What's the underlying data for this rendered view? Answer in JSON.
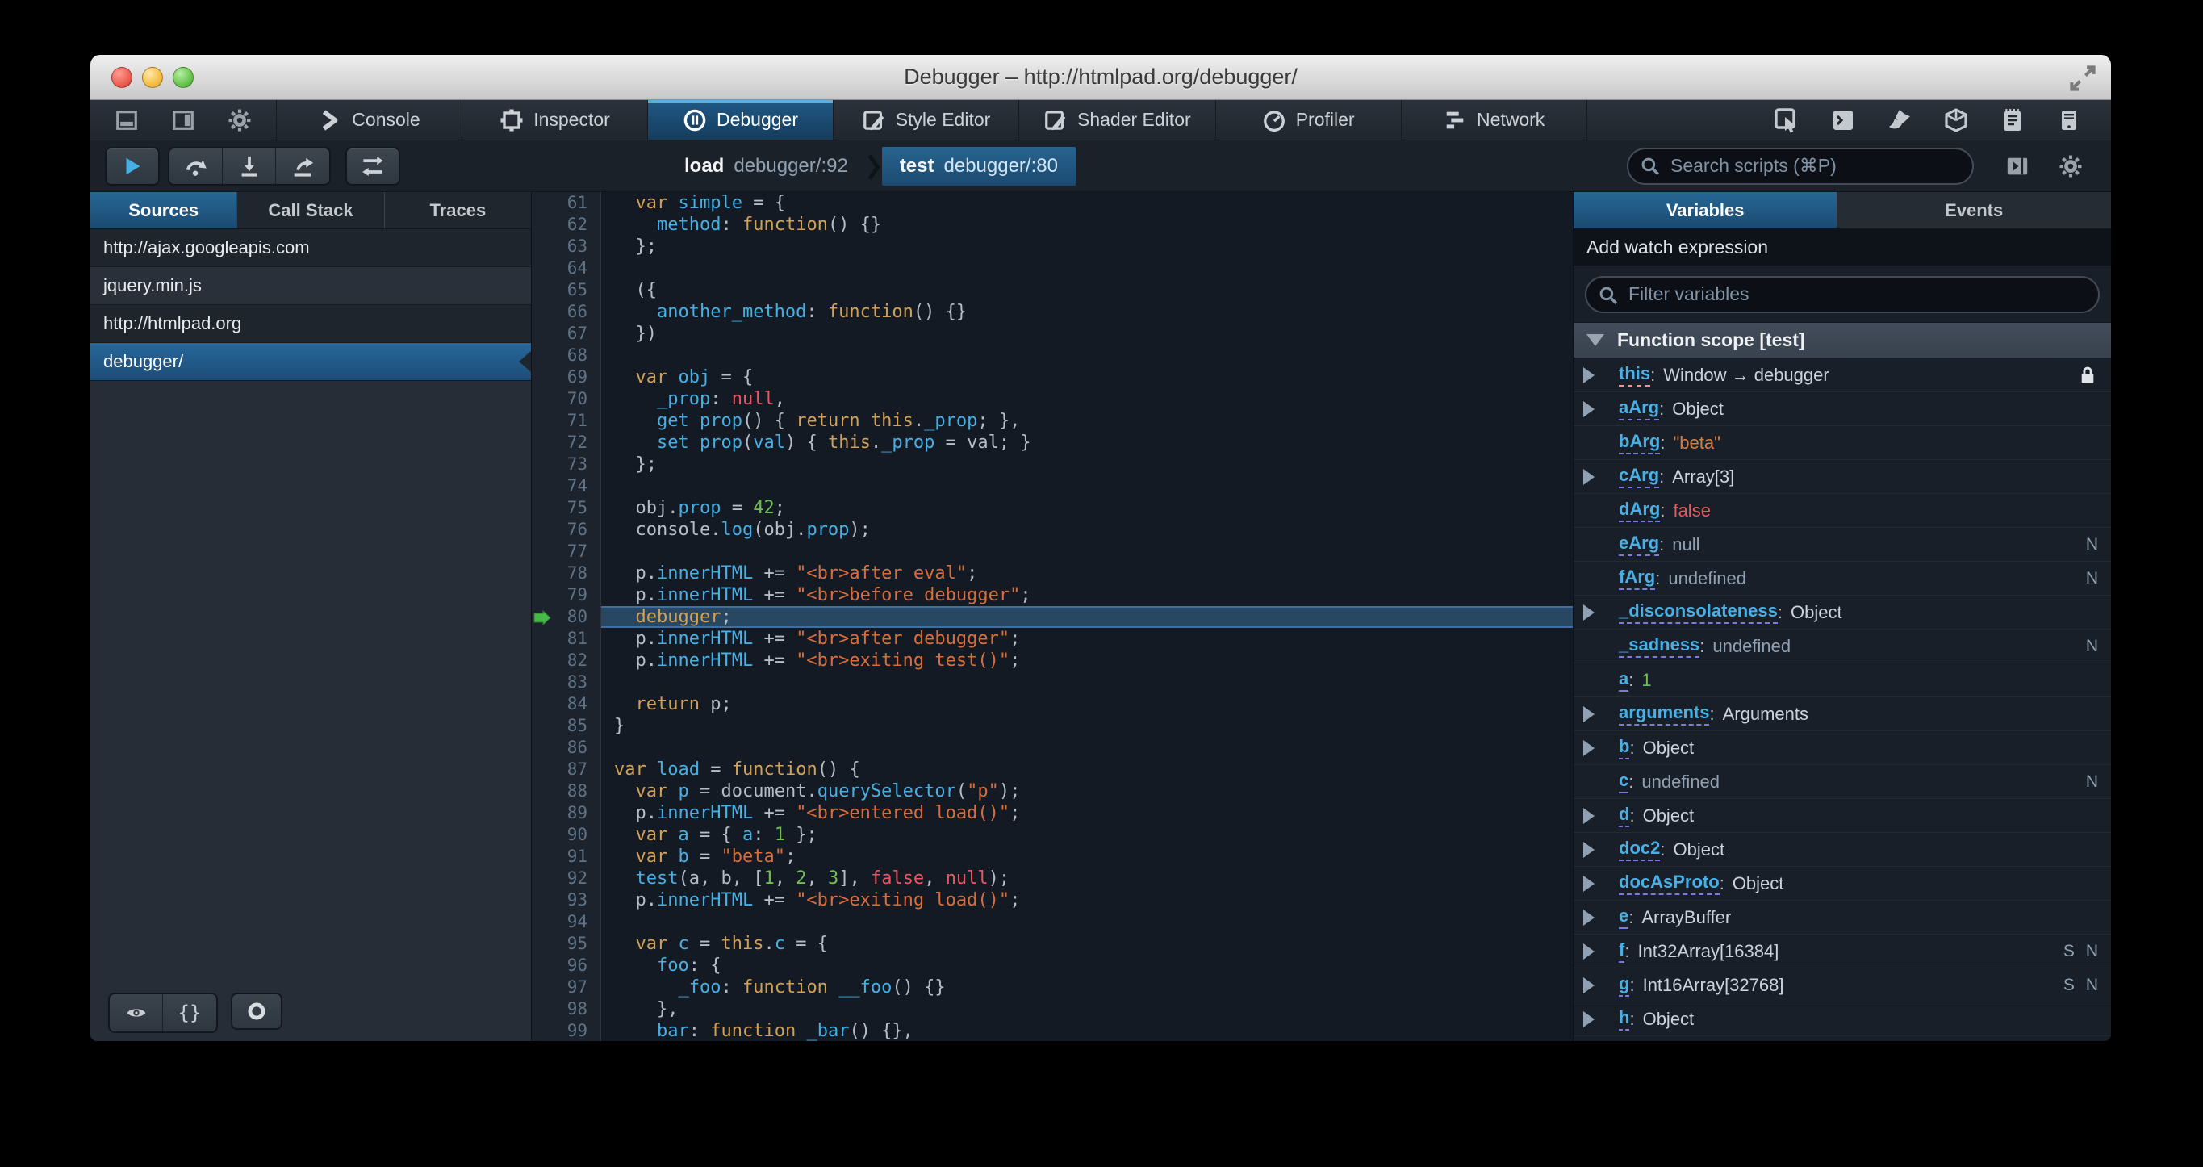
{
  "window": {
    "title": "Debugger – http://htmlpad.org/debugger/"
  },
  "titlebar": {
    "buttons": [
      "close-button",
      "minimize-button",
      "zoom-button"
    ],
    "fullscreen_icon": "fullscreen-arrows-icon"
  },
  "tabbar": {
    "controls": [
      "dock-bottom-icon",
      "dock-side-icon",
      "gear-icon"
    ],
    "tabs": [
      {
        "label": "Console",
        "icon": "console-icon",
        "selected": false
      },
      {
        "label": "Inspector",
        "icon": "inspector-icon",
        "selected": false
      },
      {
        "label": "Debugger",
        "icon": "debugger-icon",
        "selected": true
      },
      {
        "label": "Style Editor",
        "icon": "style-editor-icon",
        "selected": false
      },
      {
        "label": "Shader Editor",
        "icon": "shader-editor-icon",
        "selected": false
      },
      {
        "label": "Profiler",
        "icon": "profiler-icon",
        "selected": false
      },
      {
        "label": "Network",
        "icon": "network-icon",
        "selected": false
      }
    ],
    "toolbox_buttons": [
      "pick-element-icon",
      "split-console-icon",
      "paintbrush-icon",
      "tilt-3d-icon",
      "scratchpad-icon",
      "responsive-mode-icon"
    ]
  },
  "toolbar": {
    "debug_buttons": [
      "resume-icon",
      "step-over-icon",
      "step-in-icon",
      "step-out-icon"
    ],
    "toggle_button": "toggle-arrows-icon",
    "breadcrumb": [
      {
        "fn": "load",
        "loc": "debugger/:92",
        "active": false
      },
      {
        "fn": "test",
        "loc": "debugger/:80",
        "active": true
      }
    ],
    "search_placeholder": "Search scripts (⌘P)",
    "right_icons": [
      "panel-toggle-icon",
      "gear-icon"
    ]
  },
  "sources": {
    "tabs": [
      {
        "label": "Sources",
        "selected": true
      },
      {
        "label": "Call Stack",
        "selected": false
      },
      {
        "label": "Traces",
        "selected": false
      }
    ],
    "items": [
      {
        "label": "http://ajax.googleapis.com",
        "type": "group",
        "selected": false
      },
      {
        "label": "jquery.min.js",
        "type": "file",
        "selected": false
      },
      {
        "label": "http://htmlpad.org",
        "type": "group",
        "selected": false
      },
      {
        "label": "debugger/",
        "type": "file",
        "selected": true
      }
    ],
    "bottom_buttons": [
      "blackbox-eye-icon",
      "prettyprint-braces-icon",
      "trace-circle-icon"
    ]
  },
  "editor": {
    "current_line": 80,
    "lines": [
      {
        "n": 61,
        "t": [
          [
            "d",
            "  "
          ],
          [
            "k",
            "var"
          ],
          [
            "d",
            " "
          ],
          [
            "v",
            "simple"
          ],
          [
            "d",
            " = {"
          ]
        ]
      },
      {
        "n": 62,
        "t": [
          [
            "d",
            "    "
          ],
          [
            "v",
            "method"
          ],
          [
            "d",
            ": "
          ],
          [
            "k",
            "function"
          ],
          [
            "d",
            "() {}"
          ]
        ]
      },
      {
        "n": 63,
        "t": [
          [
            "d",
            "  };"
          ]
        ]
      },
      {
        "n": 64,
        "t": []
      },
      {
        "n": 65,
        "t": [
          [
            "d",
            "  ({"
          ]
        ]
      },
      {
        "n": 66,
        "t": [
          [
            "d",
            "    "
          ],
          [
            "v",
            "another_method"
          ],
          [
            "d",
            ": "
          ],
          [
            "k",
            "function"
          ],
          [
            "d",
            "() {}"
          ]
        ]
      },
      {
        "n": 67,
        "t": [
          [
            "d",
            "  })"
          ]
        ]
      },
      {
        "n": 68,
        "t": []
      },
      {
        "n": 69,
        "t": [
          [
            "d",
            "  "
          ],
          [
            "k",
            "var"
          ],
          [
            "d",
            " "
          ],
          [
            "v",
            "obj"
          ],
          [
            "d",
            " = {"
          ]
        ]
      },
      {
        "n": 70,
        "t": [
          [
            "d",
            "    "
          ],
          [
            "v",
            "_prop"
          ],
          [
            "d",
            ": "
          ],
          [
            "a",
            "null"
          ],
          [
            "d",
            ","
          ]
        ]
      },
      {
        "n": 71,
        "t": [
          [
            "d",
            "    "
          ],
          [
            "v",
            "get"
          ],
          [
            "d",
            " "
          ],
          [
            "v",
            "prop"
          ],
          [
            "d",
            "() { "
          ],
          [
            "k",
            "return"
          ],
          [
            "d",
            " "
          ],
          [
            "k",
            "this"
          ],
          [
            "d",
            "."
          ],
          [
            "v",
            "_prop"
          ],
          [
            "d",
            "; },"
          ]
        ]
      },
      {
        "n": 72,
        "t": [
          [
            "d",
            "    "
          ],
          [
            "v",
            "set"
          ],
          [
            "d",
            " "
          ],
          [
            "v",
            "prop"
          ],
          [
            "d",
            "("
          ],
          [
            "v",
            "val"
          ],
          [
            "d",
            ") { "
          ],
          [
            "k",
            "this"
          ],
          [
            "d",
            "."
          ],
          [
            "v",
            "_prop"
          ],
          [
            "d",
            " = val; }"
          ]
        ]
      },
      {
        "n": 73,
        "t": [
          [
            "d",
            "  };"
          ]
        ]
      },
      {
        "n": 74,
        "t": []
      },
      {
        "n": 75,
        "t": [
          [
            "d",
            "  obj."
          ],
          [
            "v",
            "prop"
          ],
          [
            "d",
            " = "
          ],
          [
            "n",
            "42"
          ],
          [
            "d",
            ";"
          ]
        ]
      },
      {
        "n": 76,
        "t": [
          [
            "d",
            "  console."
          ],
          [
            "v",
            "log"
          ],
          [
            "d",
            "(obj."
          ],
          [
            "v",
            "prop"
          ],
          [
            "d",
            ");"
          ]
        ]
      },
      {
        "n": 77,
        "t": []
      },
      {
        "n": 78,
        "t": [
          [
            "d",
            "  p."
          ],
          [
            "v",
            "innerHTML"
          ],
          [
            "d",
            " += "
          ],
          [
            "s",
            "\"<br>after eval\""
          ],
          [
            "d",
            ";"
          ]
        ]
      },
      {
        "n": 79,
        "t": [
          [
            "d",
            "  p."
          ],
          [
            "v",
            "innerHTML"
          ],
          [
            "d",
            " += "
          ],
          [
            "s",
            "\"<br>before debugger\""
          ],
          [
            "d",
            ";"
          ]
        ]
      },
      {
        "n": 80,
        "t": [
          [
            "d",
            "  "
          ],
          [
            "k",
            "debugger"
          ],
          [
            "d",
            ";"
          ]
        ]
      },
      {
        "n": 81,
        "t": [
          [
            "d",
            "  p."
          ],
          [
            "v",
            "innerHTML"
          ],
          [
            "d",
            " += "
          ],
          [
            "s",
            "\"<br>after debugger\""
          ],
          [
            "d",
            ";"
          ]
        ]
      },
      {
        "n": 82,
        "t": [
          [
            "d",
            "  p."
          ],
          [
            "v",
            "innerHTML"
          ],
          [
            "d",
            " += "
          ],
          [
            "s",
            "\"<br>exiting test()\""
          ],
          [
            "d",
            ";"
          ]
        ]
      },
      {
        "n": 83,
        "t": []
      },
      {
        "n": 84,
        "t": [
          [
            "d",
            "  "
          ],
          [
            "k",
            "return"
          ],
          [
            "d",
            " p;"
          ]
        ]
      },
      {
        "n": 85,
        "t": [
          [
            "d",
            "}"
          ]
        ]
      },
      {
        "n": 86,
        "t": []
      },
      {
        "n": 87,
        "t": [
          [
            "k",
            "var"
          ],
          [
            "d",
            " "
          ],
          [
            "v",
            "load"
          ],
          [
            "d",
            " = "
          ],
          [
            "k",
            "function"
          ],
          [
            "d",
            "() {"
          ]
        ]
      },
      {
        "n": 88,
        "t": [
          [
            "d",
            "  "
          ],
          [
            "k",
            "var"
          ],
          [
            "d",
            " "
          ],
          [
            "v",
            "p"
          ],
          [
            "d",
            " = document."
          ],
          [
            "v",
            "querySelector"
          ],
          [
            "d",
            "("
          ],
          [
            "s",
            "\"p\""
          ],
          [
            "d",
            ");"
          ]
        ]
      },
      {
        "n": 89,
        "t": [
          [
            "d",
            "  p."
          ],
          [
            "v",
            "innerHTML"
          ],
          [
            "d",
            " += "
          ],
          [
            "s",
            "\"<br>entered load()\""
          ],
          [
            "d",
            ";"
          ]
        ]
      },
      {
        "n": 90,
        "t": [
          [
            "d",
            "  "
          ],
          [
            "k",
            "var"
          ],
          [
            "d",
            " "
          ],
          [
            "v",
            "a"
          ],
          [
            "d",
            " = { "
          ],
          [
            "v",
            "a"
          ],
          [
            "d",
            ": "
          ],
          [
            "n",
            "1"
          ],
          [
            "d",
            " };"
          ]
        ]
      },
      {
        "n": 91,
        "t": [
          [
            "d",
            "  "
          ],
          [
            "k",
            "var"
          ],
          [
            "d",
            " "
          ],
          [
            "v",
            "b"
          ],
          [
            "d",
            " = "
          ],
          [
            "s",
            "\"beta\""
          ],
          [
            "d",
            ";"
          ]
        ]
      },
      {
        "n": 92,
        "t": [
          [
            "d",
            "  "
          ],
          [
            "v",
            "test"
          ],
          [
            "d",
            "(a, b, ["
          ],
          [
            "n",
            "1"
          ],
          [
            "d",
            ", "
          ],
          [
            "n",
            "2"
          ],
          [
            "d",
            ", "
          ],
          [
            "n",
            "3"
          ],
          [
            "d",
            "], "
          ],
          [
            "a",
            "false"
          ],
          [
            "d",
            ", "
          ],
          [
            "a",
            "null"
          ],
          [
            "d",
            ");"
          ]
        ]
      },
      {
        "n": 93,
        "t": [
          [
            "d",
            "  p."
          ],
          [
            "v",
            "innerHTML"
          ],
          [
            "d",
            " += "
          ],
          [
            "s",
            "\"<br>exiting load()\""
          ],
          [
            "d",
            ";"
          ]
        ]
      },
      {
        "n": 94,
        "t": []
      },
      {
        "n": 95,
        "t": [
          [
            "d",
            "  "
          ],
          [
            "k",
            "var"
          ],
          [
            "d",
            " "
          ],
          [
            "v",
            "c"
          ],
          [
            "d",
            " = "
          ],
          [
            "k",
            "this"
          ],
          [
            "d",
            "."
          ],
          [
            "v",
            "c"
          ],
          [
            "d",
            " = {"
          ]
        ]
      },
      {
        "n": 96,
        "t": [
          [
            "d",
            "    "
          ],
          [
            "v",
            "foo"
          ],
          [
            "d",
            ": {"
          ]
        ]
      },
      {
        "n": 97,
        "t": [
          [
            "d",
            "      "
          ],
          [
            "v",
            "_foo"
          ],
          [
            "d",
            ": "
          ],
          [
            "k",
            "function"
          ],
          [
            "d",
            " "
          ],
          [
            "v",
            "__foo"
          ],
          [
            "d",
            "() {}"
          ]
        ]
      },
      {
        "n": 98,
        "t": [
          [
            "d",
            "    },"
          ]
        ]
      },
      {
        "n": 99,
        "t": [
          [
            "d",
            "    "
          ],
          [
            "v",
            "bar"
          ],
          [
            "d",
            ": "
          ],
          [
            "k",
            "function"
          ],
          [
            "d",
            " "
          ],
          [
            "v",
            "_bar"
          ],
          [
            "d",
            "() {},"
          ]
        ]
      }
    ]
  },
  "variables": {
    "tabs": [
      {
        "label": "Variables",
        "selected": true
      },
      {
        "label": "Events",
        "selected": false
      }
    ],
    "watch_label": "Add watch expression",
    "filter_placeholder": "Filter variables",
    "scope_label": "Function scope [test]",
    "rows": [
      {
        "name": "this",
        "value": "Window → debugger",
        "vt": "plain",
        "expand": true,
        "lock": true,
        "underline": "pink",
        "badges": []
      },
      {
        "name": "aArg",
        "value": "Object",
        "vt": "plain",
        "expand": true,
        "badges": []
      },
      {
        "name": "bArg",
        "value": "\"beta\"",
        "vt": "str",
        "expand": false,
        "badges": []
      },
      {
        "name": "cArg",
        "value": "Array[3]",
        "vt": "plain",
        "expand": true,
        "badges": []
      },
      {
        "name": "dArg",
        "value": "false",
        "vt": "atom",
        "expand": false,
        "badges": []
      },
      {
        "name": "eArg",
        "value": "null",
        "vt": "dim",
        "expand": false,
        "badges": [
          "N"
        ]
      },
      {
        "name": "fArg",
        "value": "undefined",
        "vt": "dim",
        "expand": false,
        "badges": [
          "N"
        ]
      },
      {
        "name": "_disconsolateness",
        "value": "Object",
        "vt": "plain",
        "expand": true,
        "badges": []
      },
      {
        "name": "_sadness",
        "value": "undefined",
        "vt": "dim",
        "expand": false,
        "badges": [
          "N"
        ]
      },
      {
        "name": "a",
        "value": "1",
        "vt": "num",
        "expand": false,
        "badges": []
      },
      {
        "name": "arguments",
        "value": "Arguments",
        "vt": "plain",
        "expand": true,
        "badges": []
      },
      {
        "name": "b",
        "value": "Object",
        "vt": "plain",
        "expand": true,
        "badges": []
      },
      {
        "name": "c",
        "value": "undefined",
        "vt": "dim",
        "expand": false,
        "badges": [
          "N"
        ]
      },
      {
        "name": "d",
        "value": "Object",
        "vt": "plain",
        "expand": true,
        "badges": []
      },
      {
        "name": "doc2",
        "value": "Object",
        "vt": "plain",
        "expand": true,
        "badges": []
      },
      {
        "name": "docAsProto",
        "value": "Object",
        "vt": "plain",
        "expand": true,
        "badges": []
      },
      {
        "name": "e",
        "value": "ArrayBuffer",
        "vt": "plain",
        "expand": true,
        "badges": []
      },
      {
        "name": "f",
        "value": "Int32Array[16384]",
        "vt": "plain",
        "expand": true,
        "badges": [
          "S",
          "N"
        ]
      },
      {
        "name": "g",
        "value": "Int16Array[32768]",
        "vt": "plain",
        "expand": true,
        "badges": [
          "S",
          "N"
        ]
      },
      {
        "name": "h",
        "value": "Object",
        "vt": "plain",
        "expand": true,
        "badges": []
      }
    ]
  }
}
